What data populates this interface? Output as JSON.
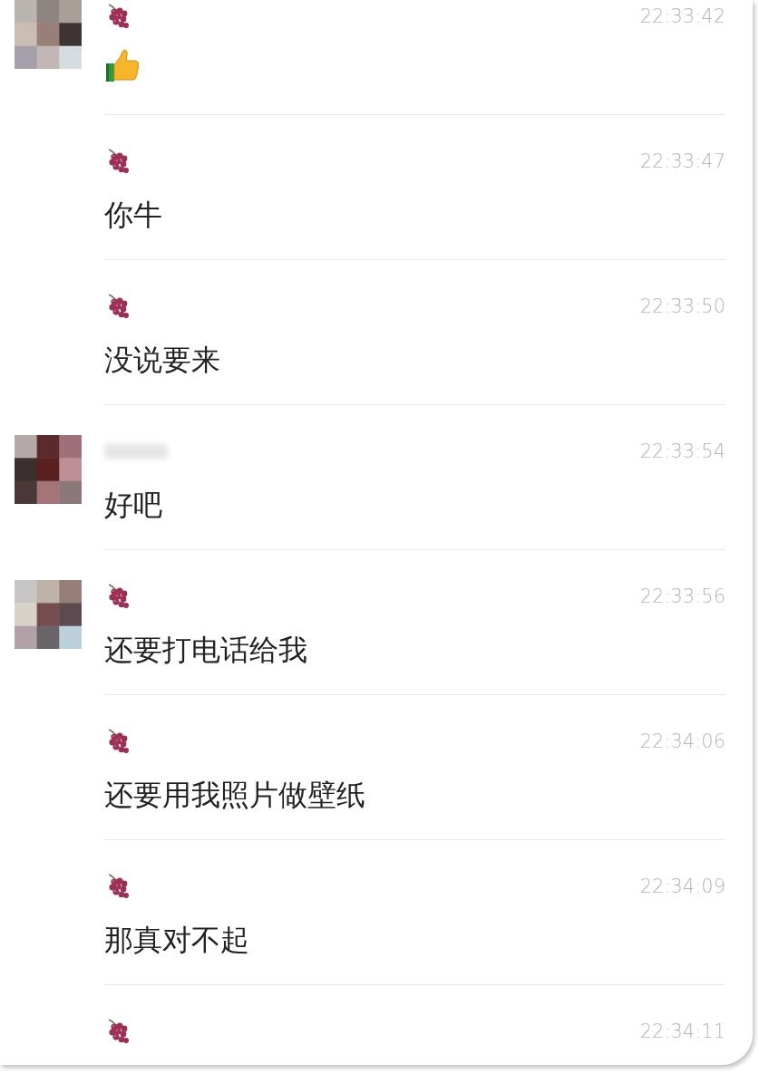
{
  "messages": [
    {
      "show_avatar": true,
      "sender": {
        "kind": "icon"
      },
      "time": "22:33:42",
      "kind": "thumbs_up"
    },
    {
      "show_avatar": false,
      "sender": {
        "kind": "icon"
      },
      "time": "22:33:47",
      "kind": "text",
      "text": "你牛"
    },
    {
      "show_avatar": false,
      "sender": {
        "kind": "icon"
      },
      "time": "22:33:50",
      "kind": "text",
      "text": "没说要来"
    },
    {
      "show_avatar": true,
      "sender": {
        "kind": "blurred"
      },
      "time": "22:33:54",
      "kind": "text",
      "text": "好吧"
    },
    {
      "show_avatar": true,
      "sender": {
        "kind": "icon"
      },
      "time": "22:33:56",
      "kind": "text",
      "text": "还要打电话给我"
    },
    {
      "show_avatar": false,
      "sender": {
        "kind": "icon"
      },
      "time": "22:34:06",
      "kind": "text",
      "text": "还要用我照片做壁纸"
    },
    {
      "show_avatar": false,
      "sender": {
        "kind": "icon"
      },
      "time": "22:34:09",
      "kind": "text",
      "text": "那真对不起"
    },
    {
      "show_avatar": false,
      "sender": {
        "kind": "icon"
      },
      "time": "22:34:11",
      "kind": "none"
    }
  ]
}
